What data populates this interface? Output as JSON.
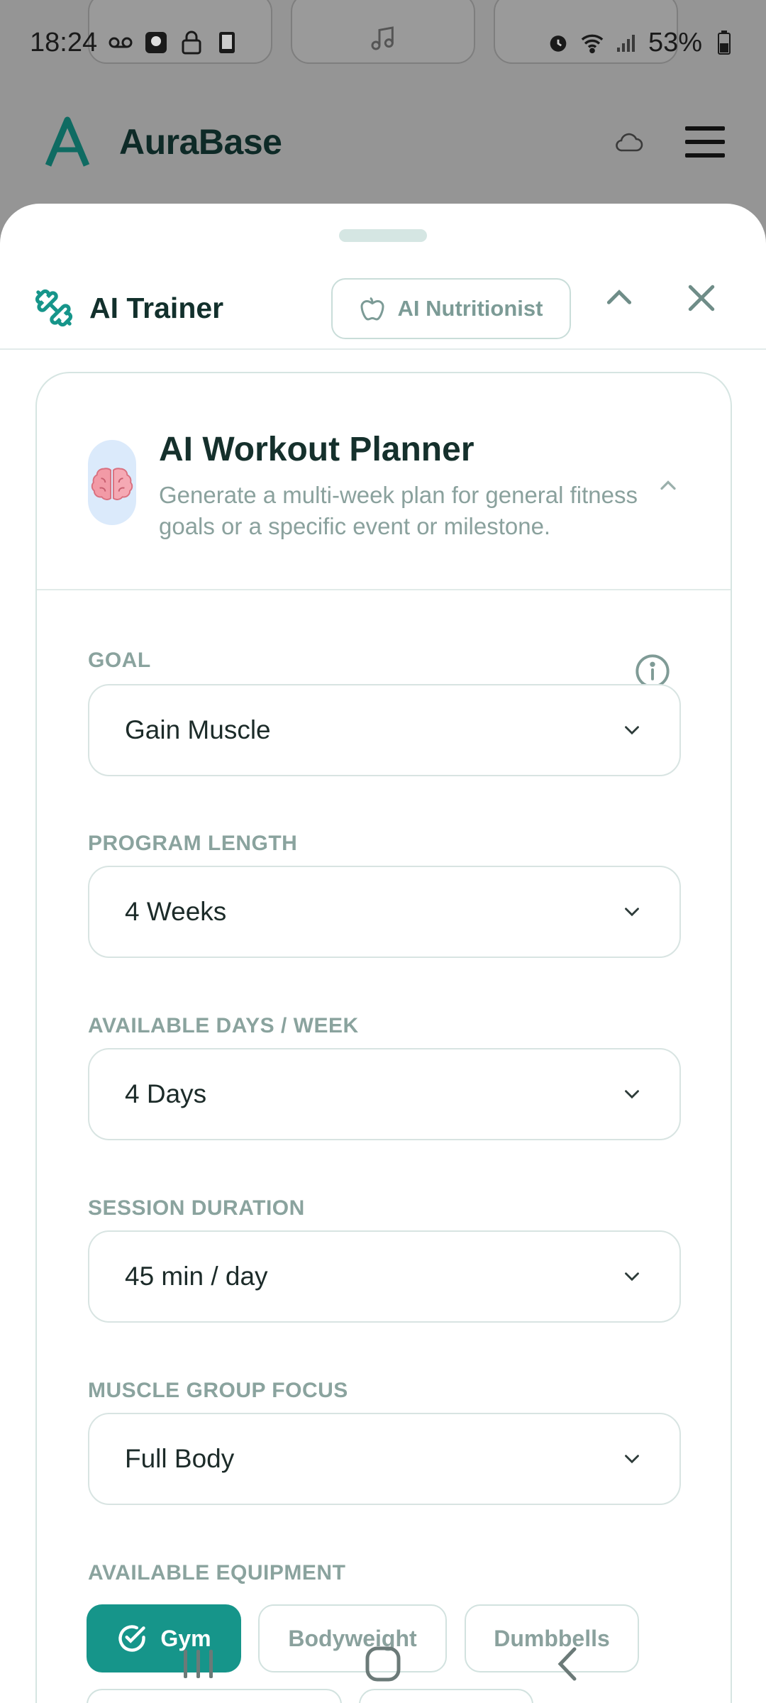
{
  "status_bar": {
    "time": "18:24",
    "battery": "53%"
  },
  "app": {
    "name": "AuraBase",
    "brand_color": "#157a70"
  },
  "sheet": {
    "title": "AI Trainer",
    "nutritionist_label": "AI Nutritionist"
  },
  "planner": {
    "title": "AI Workout Planner",
    "subtitle": "Generate a multi-week plan for general fitness goals or a specific event or milestone."
  },
  "fields": {
    "goal": {
      "label": "GOAL",
      "value": "Gain Muscle"
    },
    "program_length": {
      "label": "PROGRAM LENGTH",
      "value": "4 Weeks"
    },
    "available_days": {
      "label": "AVAILABLE DAYS / WEEK",
      "value": "4 Days"
    },
    "session_duration": {
      "label": "SESSION DURATION",
      "value": "45 min / day"
    },
    "muscle_focus": {
      "label": "MUSCLE GROUP FOCUS",
      "value": "Full Body"
    },
    "equipment": {
      "label": "AVAILABLE EQUIPMENT",
      "options": [
        {
          "label": "Gym",
          "selected": true
        },
        {
          "label": "Bodyweight",
          "selected": false
        },
        {
          "label": "Dumbbells",
          "selected": false
        }
      ]
    }
  },
  "colors": {
    "accent": "#16958a",
    "muted_text": "#8aa19d",
    "border": "#d8e4e2"
  }
}
